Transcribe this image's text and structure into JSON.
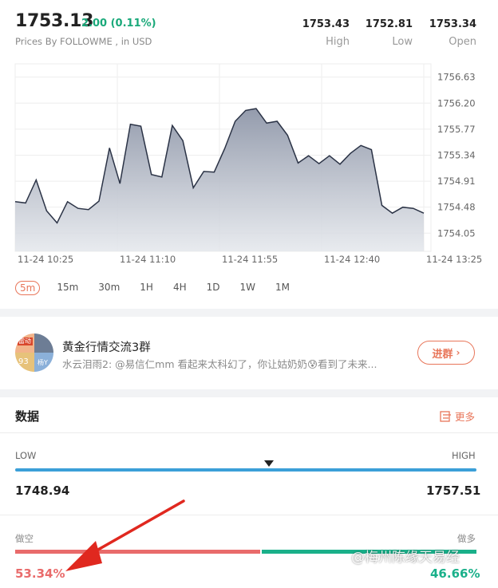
{
  "header": {
    "price": "1753.13",
    "change": "2.00 (0.11%)",
    "source": "Prices By FOLLOWME , in USD",
    "stats": [
      {
        "value": "1753.43",
        "label": "High"
      },
      {
        "value": "1752.81",
        "label": "Low"
      },
      {
        "value": "1753.34",
        "label": "Open"
      }
    ]
  },
  "chart_data": {
    "type": "area",
    "x": [
      "11-24 10:25",
      "11-24 10:30",
      "11-24 10:35",
      "11-24 10:40",
      "11-24 10:45",
      "11-24 10:50",
      "11-24 10:55",
      "11-24 11:00",
      "11-24 11:05",
      "11-24 11:10",
      "11-24 11:15",
      "11-24 11:20",
      "11-24 11:25",
      "11-24 11:30",
      "11-24 11:35",
      "11-24 11:40",
      "11-24 11:45",
      "11-24 11:50",
      "11-24 11:55",
      "11-24 12:00",
      "11-24 12:05",
      "11-24 12:10",
      "11-24 12:15",
      "11-24 12:20",
      "11-24 12:25",
      "11-24 12:30",
      "11-24 12:35",
      "11-24 12:40",
      "11-24 12:45",
      "11-24 12:50",
      "11-24 12:55",
      "11-24 13:00",
      "11-24 13:05",
      "11-24 13:10",
      "11-24 13:15",
      "11-24 13:20",
      "11-24 13:25"
    ],
    "values": [
      1754.57,
      1754.55,
      1754.93,
      1754.42,
      1754.22,
      1754.57,
      1754.46,
      1754.44,
      1754.58,
      1755.46,
      1754.87,
      1755.85,
      1755.82,
      1755.02,
      1754.98,
      1755.83,
      1755.58,
      1754.8,
      1755.07,
      1755.06,
      1755.45,
      1755.9,
      1756.08,
      1756.11,
      1755.87,
      1755.9,
      1755.67,
      1755.21,
      1755.33,
      1755.2,
      1755.33,
      1755.19,
      1755.37,
      1755.5,
      1755.43,
      1754.51,
      1754.38,
      1754.48,
      1754.46,
      1754.38
    ],
    "x_tick_labels": [
      "11-24 10:25",
      "11-24 11:10",
      "11-24 11:55",
      "11-24 12:40",
      "11-24 13:25"
    ],
    "y_ticks": [
      1756.63,
      1756.2,
      1755.77,
      1755.34,
      1754.91,
      1754.48,
      1754.05
    ],
    "ylim": [
      1753.75,
      1756.85
    ],
    "grid": true,
    "line_color": "#2b3346"
  },
  "timeframes": [
    "5m",
    "15m",
    "30m",
    "1H",
    "4H",
    "1D",
    "1W",
    "1M"
  ],
  "active_timeframe": "5m",
  "group": {
    "name": "黄金行情交流3群",
    "avatar_text_tl": "雷动",
    "avatar_text_bl": "93",
    "avatar_text_br": "杨Y",
    "message": "水云泪雨2: @易信仁mm 看起来太科幻了，你让姑奶奶😰看到了未来...",
    "join_label": "进群"
  },
  "data_section": {
    "title": "数据",
    "more_label": "更多",
    "range": {
      "low_label": "LOW",
      "high_label": "HIGH",
      "low_value": "1748.94",
      "high_value": "1757.51",
      "current_position": 0.55
    },
    "sentiment": {
      "short_label": "做空",
      "long_label": "做多",
      "short_pct": "53.34%",
      "long_pct": "46.66%",
      "short_fraction": 0.5334,
      "short_color": "#e96b6b",
      "long_color": "#1ab08a"
    }
  },
  "watermark": "@梅州陈缘天易经"
}
